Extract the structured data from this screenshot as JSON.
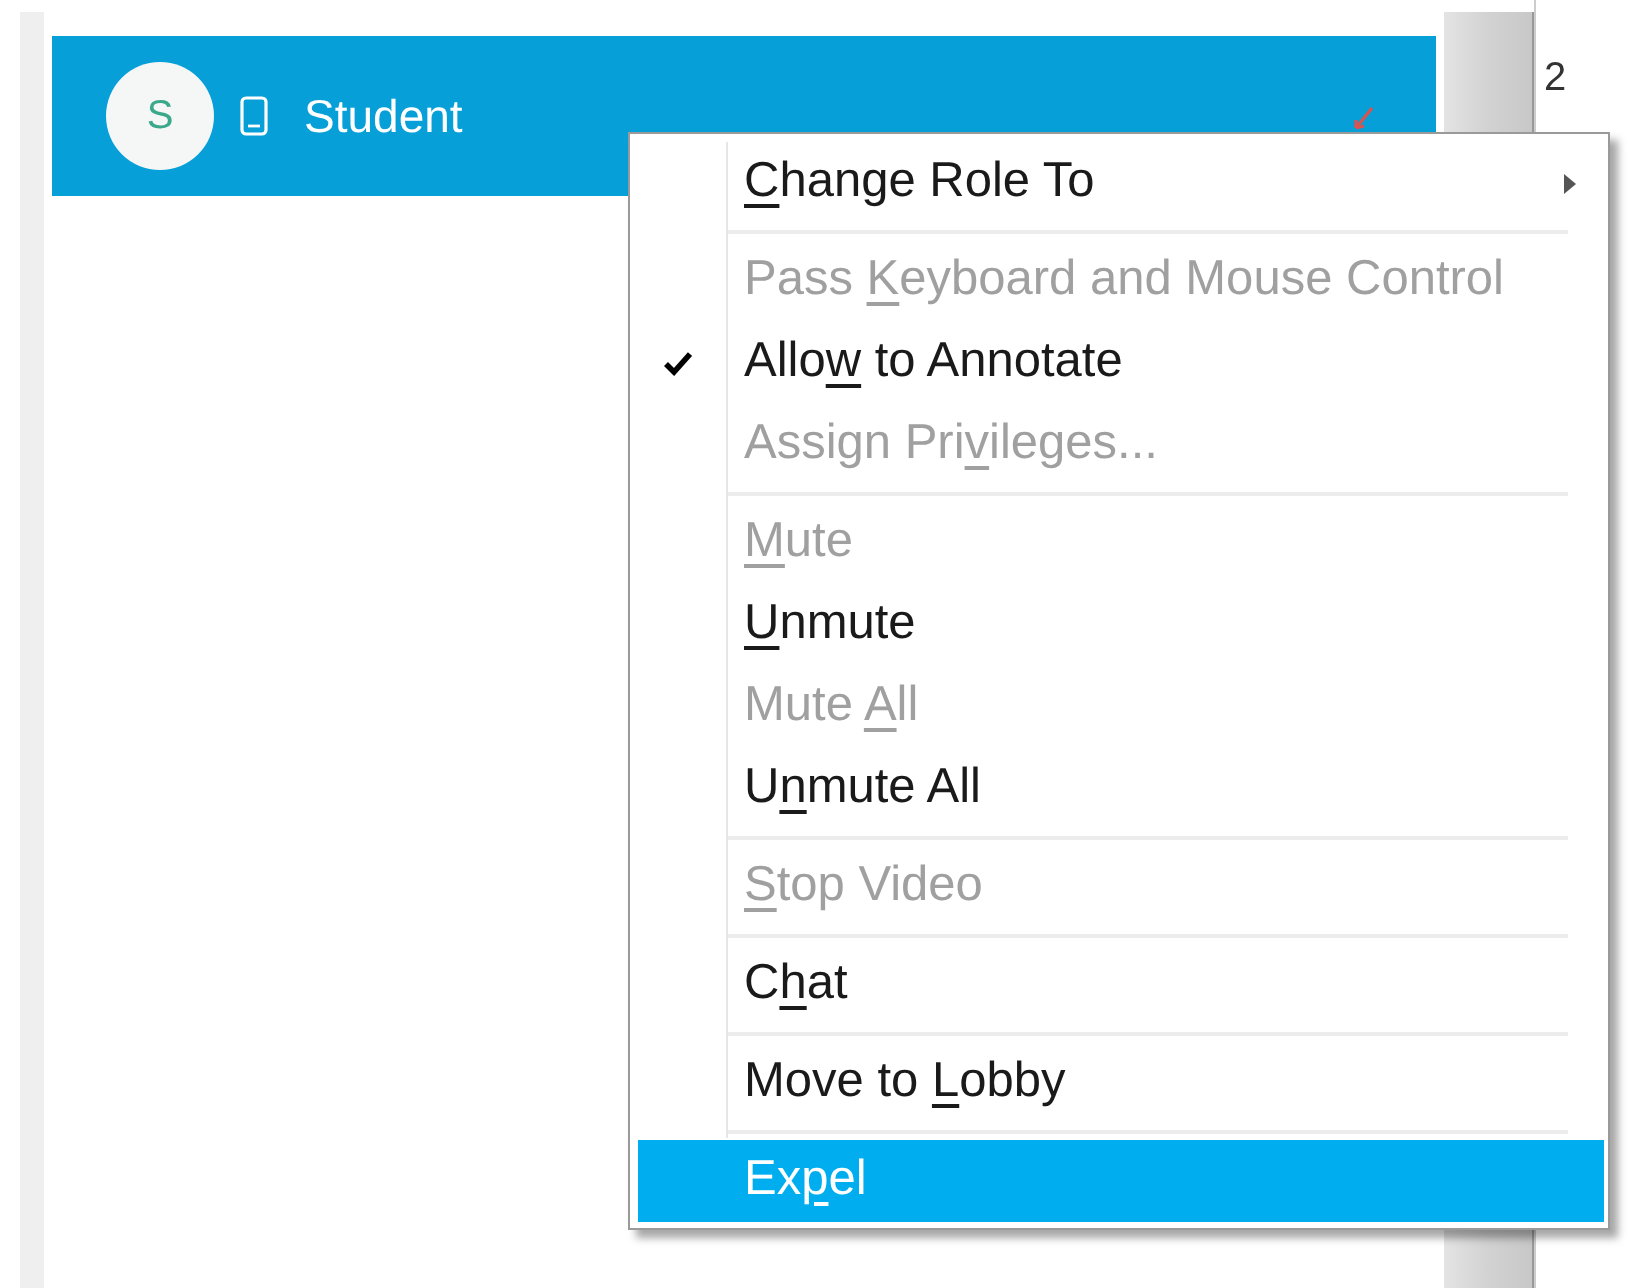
{
  "participant": {
    "initial": "S",
    "name": "Student"
  },
  "side_text": "2",
  "menu": {
    "groups": [
      {
        "items": [
          {
            "key": "C",
            "after": "hange Role To",
            "disabled": false,
            "checked": false,
            "submenu": true,
            "selected": false
          }
        ]
      },
      {
        "items": [
          {
            "before": "Pass ",
            "key": "K",
            "after": "eyboard and Mouse Control",
            "disabled": true,
            "checked": false,
            "submenu": false,
            "selected": false
          },
          {
            "before": "Allo",
            "key": "w",
            "after": " to Annotate",
            "disabled": false,
            "checked": true,
            "submenu": false,
            "selected": false
          },
          {
            "before": "Assign Pri",
            "key": "v",
            "after": "ileges...",
            "disabled": true,
            "checked": false,
            "submenu": false,
            "selected": false
          }
        ]
      },
      {
        "items": [
          {
            "key": "M",
            "after": "ute",
            "disabled": true,
            "checked": false,
            "submenu": false,
            "selected": false
          },
          {
            "key": "U",
            "after": "nmute",
            "disabled": false,
            "checked": false,
            "submenu": false,
            "selected": false
          },
          {
            "before": "Mute ",
            "key": "A",
            "after": "ll",
            "disabled": true,
            "checked": false,
            "submenu": false,
            "selected": false
          },
          {
            "before": "U",
            "key": "n",
            "after": "mute All",
            "disabled": false,
            "checked": false,
            "submenu": false,
            "selected": false
          }
        ]
      },
      {
        "items": [
          {
            "key": "S",
            "after": "top Video",
            "disabled": true,
            "checked": false,
            "submenu": false,
            "selected": false
          }
        ]
      },
      {
        "items": [
          {
            "before": "C",
            "key": "h",
            "after": "at",
            "disabled": false,
            "checked": false,
            "submenu": false,
            "selected": false
          }
        ]
      },
      {
        "items": [
          {
            "before": "Move to ",
            "key": "L",
            "after": "obby",
            "disabled": false,
            "checked": false,
            "submenu": false,
            "selected": false
          }
        ]
      },
      {
        "items": [
          {
            "before": "Ex",
            "key": "p",
            "after": "el",
            "disabled": false,
            "checked": false,
            "submenu": false,
            "selected": true
          }
        ]
      }
    ]
  }
}
